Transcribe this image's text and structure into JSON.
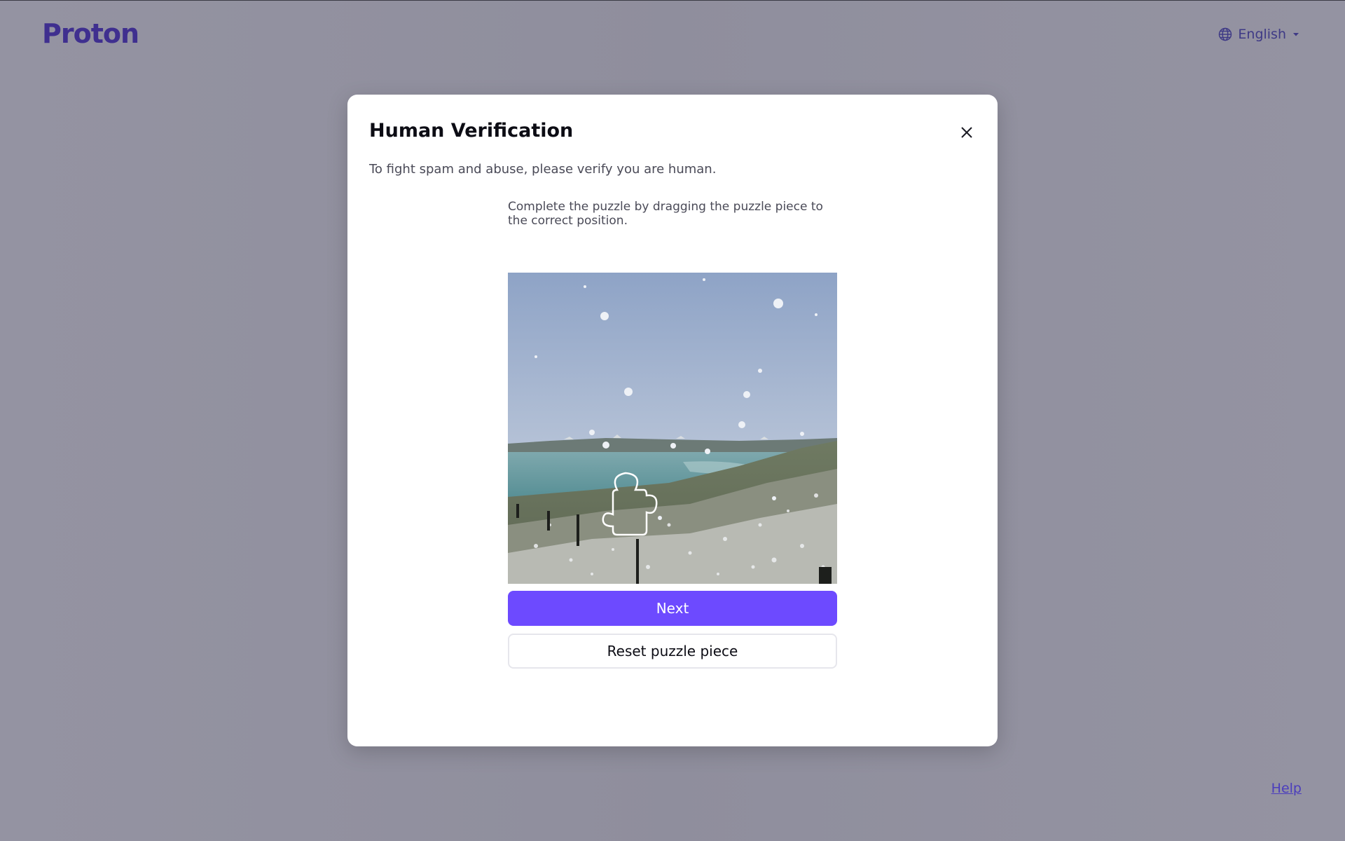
{
  "header": {
    "brand": "Proton",
    "language": "English",
    "language_icon": "globe-icon",
    "dropdown_icon": "caret-down-icon"
  },
  "modal": {
    "title": "Human Verification",
    "description": "To fight spam and abuse, please verify you are human.",
    "instructions": "Complete the puzzle by dragging the puzzle piece to the correct position.",
    "close_icon": "close-icon",
    "next_label": "Next",
    "reset_label": "Reset puzzle piece"
  },
  "footer": {
    "help_label": "Help"
  },
  "colors": {
    "brand": "#3f2f8f",
    "primary_button": "#6d4aff",
    "overlay": "#9291a0",
    "link": "#4b3dbd"
  }
}
